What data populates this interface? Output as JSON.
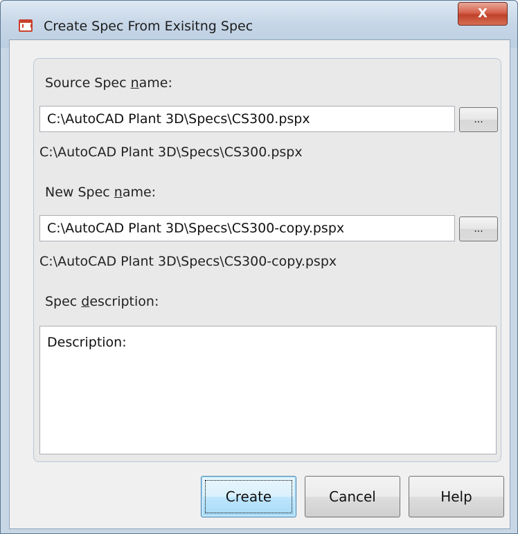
{
  "window": {
    "title": "Create Spec From Exisitng Spec",
    "icon": "spec-dialog-icon",
    "close_label": "X"
  },
  "source": {
    "label_prefix": "Source Spec ",
    "label_accel": "n",
    "label_suffix": "ame:",
    "value": "C:\\AutoCAD Plant 3D\\Specs\\CS300.pspx",
    "path_display": "C:\\AutoCAD Plant 3D\\Specs\\CS300.pspx",
    "browse_label": "..."
  },
  "new_spec": {
    "label_prefix": "New Spec ",
    "label_accel": "n",
    "label_suffix": "ame:",
    "value": "C:\\AutoCAD Plant 3D\\Specs\\CS300-copy.pspx",
    "path_display": "C:\\AutoCAD Plant 3D\\Specs\\CS300-copy.pspx",
    "browse_label": "..."
  },
  "description": {
    "label_prefix": "Spec ",
    "label_accel": "d",
    "label_suffix": "escription:",
    "value": "Description:"
  },
  "buttons": {
    "create": "Create",
    "cancel": "Cancel",
    "help": "Help"
  },
  "colors": {
    "titlebar": "#c6d6e7",
    "close_button": "#c0412b",
    "default_button": "#bee6fd"
  }
}
